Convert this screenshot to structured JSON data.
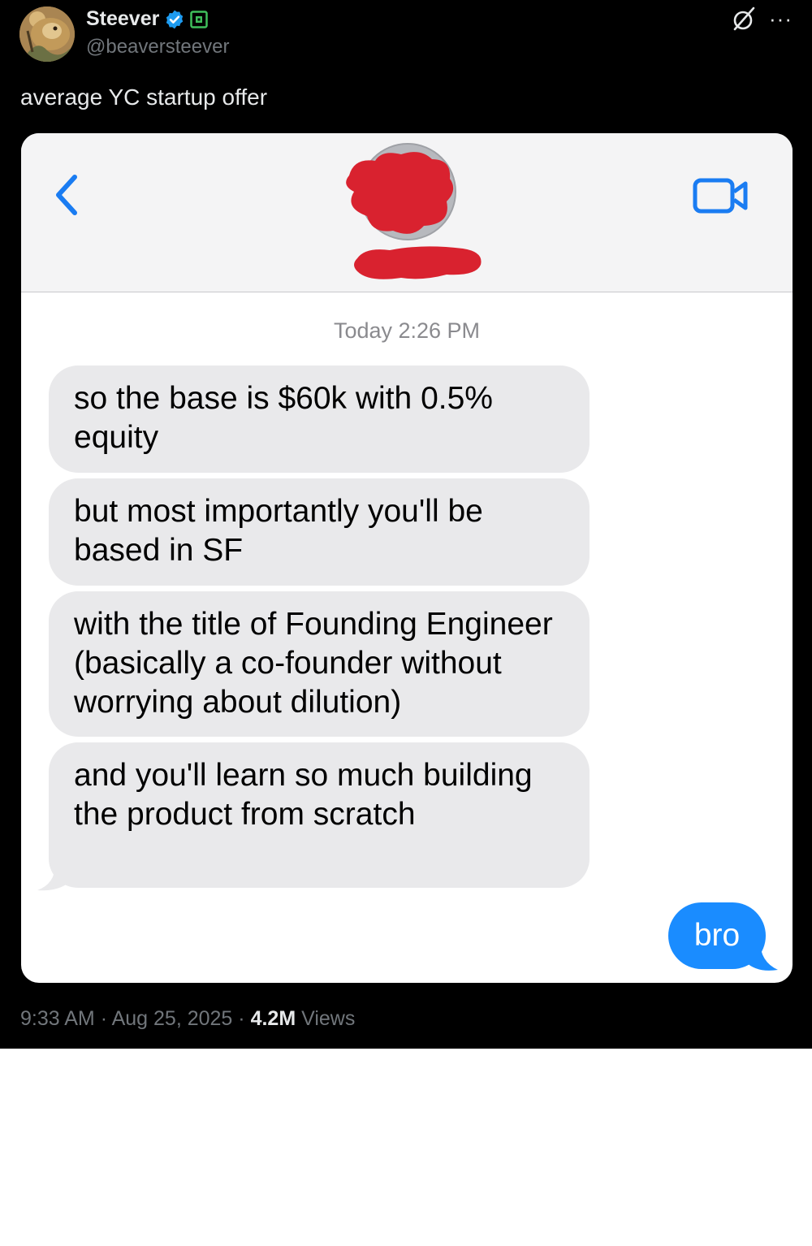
{
  "author": {
    "name": "Steever",
    "handle": "@beaversteever",
    "avatar": "beaver-avatar"
  },
  "tweet": {
    "text": "average YC startup offer"
  },
  "icons": {
    "verified": "verified-badge-icon",
    "affiliate": "affiliate-badge-icon",
    "grok": "grok-icon",
    "more": "more-icon"
  },
  "screenshot": {
    "header": {
      "back_icon": "chevron-left-icon",
      "video_icon": "video-camera-icon",
      "contact_redacted": true
    },
    "timestamp": "Today 2:26 PM",
    "received": [
      "so the base is $60k with 0.5% equity",
      "but most importantly you'll be based in SF",
      "with the title of Founding Engineer (basically a co-founder without worrying about dilution)",
      "and you'll learn so much building the product from scratch"
    ],
    "sent": "bro",
    "colors": {
      "received_bubble": "#e9e9eb",
      "sent_bubble": "#1a8cff",
      "ios_blue": "#1a7cf2",
      "redaction": "#d9222f"
    }
  },
  "meta": {
    "time": "9:33 AM",
    "date": "Aug 25, 2025",
    "separator": "·",
    "views_count": "4.2M",
    "views_label": "Views"
  }
}
